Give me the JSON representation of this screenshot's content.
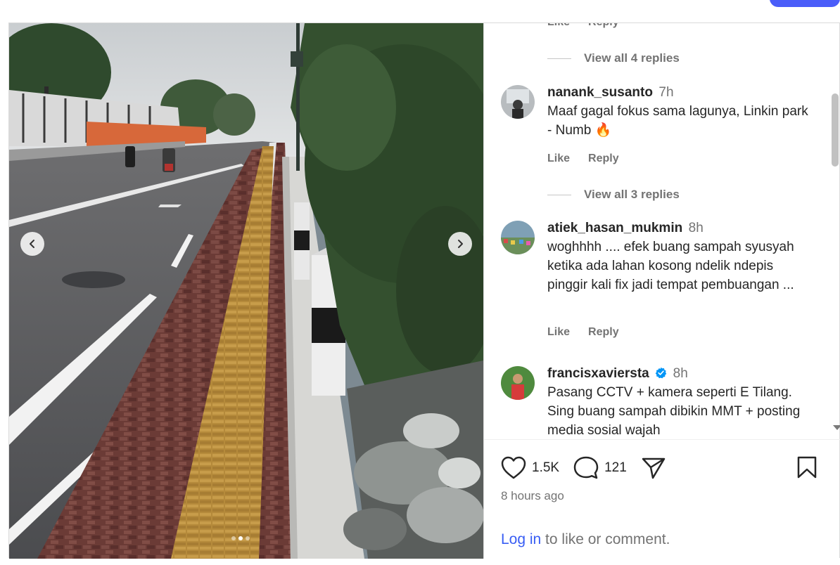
{
  "post": {
    "carousel": {
      "slide_count": 3,
      "active_slide": 2
    },
    "comments_panel": {
      "top_actions": {
        "like_label": "Like",
        "reply_label": "Reply"
      },
      "view_replies_1": "View all 4 replies",
      "comments": [
        {
          "username": "nanank_susanto",
          "time": "7h",
          "text": "Maaf gagal fokus sama lagunya, Linkin park - Numb 🔥",
          "like_label": "Like",
          "reply_label": "Reply",
          "view_replies": "View all 3 replies"
        },
        {
          "username": "atiek_hasan_mukmin",
          "time": "8h",
          "text": "woghhhh .... efek buang sampah syusyah ketika ada lahan kosong ndelik ndepis pinggir kali fix jadi tempat pembuangan ...",
          "like_label": "Like",
          "reply_label": "Reply"
        },
        {
          "username": "francisxavierst​a",
          "time": "8h",
          "verified": true,
          "text": "Pasang CCTV + kamera seperti E Tilang. Sing buang sampah dibikin MMT + posting media sosial wajah"
        }
      ]
    },
    "footer": {
      "like_count": "1.5K",
      "comment_count": "121",
      "posted_time": "8 hours ago",
      "login_link": "Log in",
      "login_suffix": " to like or comment."
    },
    "colors": {
      "accent_blue": "#385df4",
      "verified_blue": "#0095f6",
      "muted_text": "#737373"
    },
    "icons": [
      "heart-icon",
      "comment-icon",
      "share-icon",
      "bookmark-icon",
      "chevron-left-icon",
      "chevron-right-icon",
      "verified-badge-icon"
    ]
  }
}
